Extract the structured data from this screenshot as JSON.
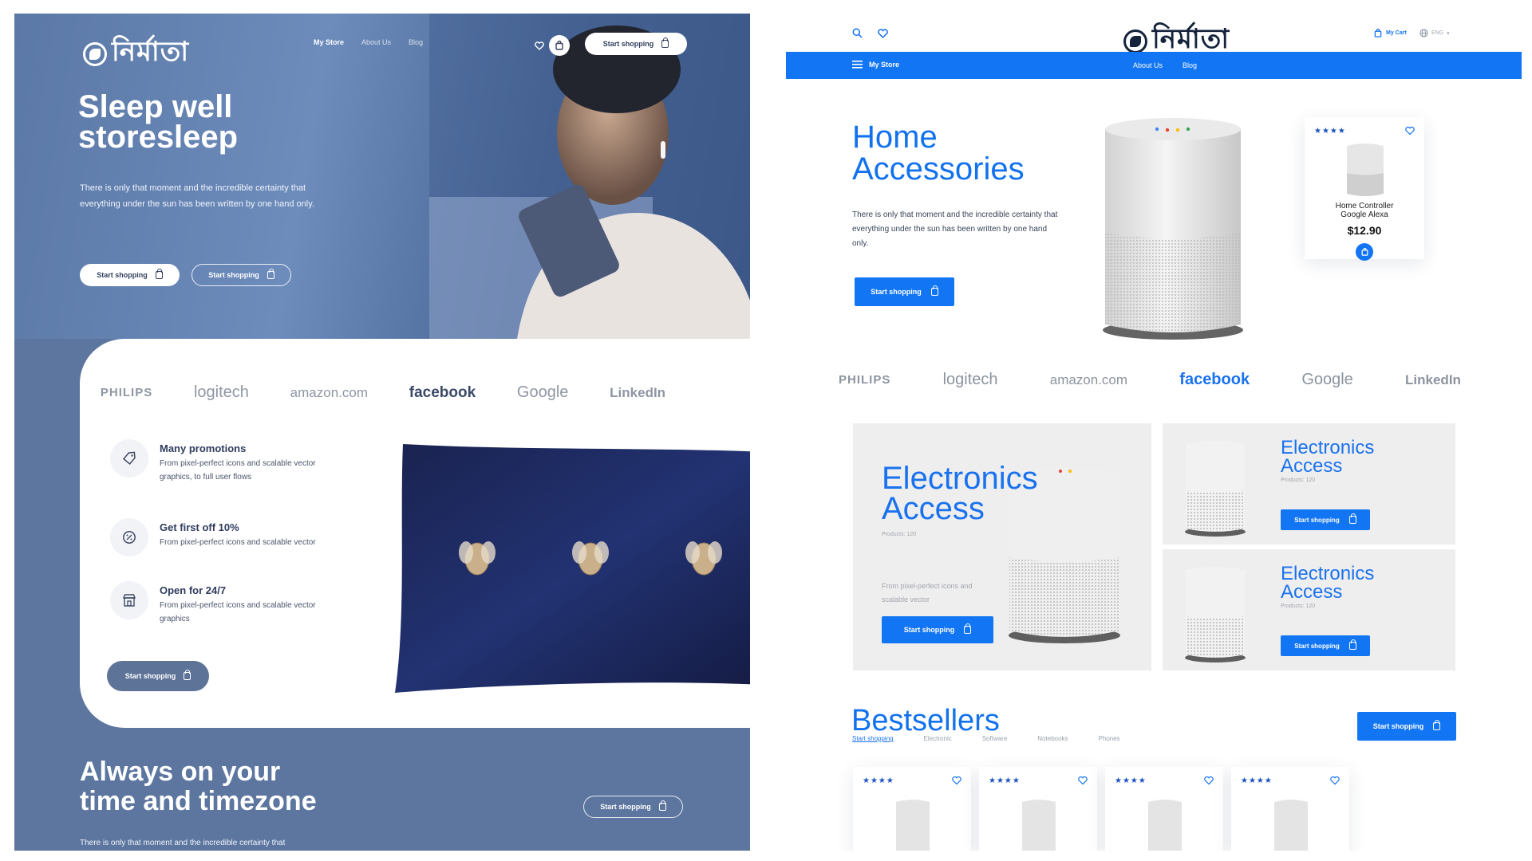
{
  "left": {
    "logo": "নির্মাতা",
    "nav": {
      "store": "My Store",
      "about": "About Us",
      "blog": "Blog"
    },
    "header_button": "Start shopping",
    "hero": {
      "title_line1": "Sleep well",
      "title_line2": "storesleep",
      "text": "There is only that moment and the incredible certainty that everything under the sun has been written by one hand only.",
      "button_primary": "Start shopping",
      "button_secondary": "Start shopping"
    },
    "brands": [
      "PHILIPS",
      "logitech",
      "amazon.com",
      "facebook",
      "Google",
      "LinkedIn"
    ],
    "features": [
      {
        "title": "Many promotions",
        "text": "From pixel-perfect icons and scalable vector graphics, to full user flows",
        "icon": "tag-icon"
      },
      {
        "title": "Get first off 10%",
        "text": "From pixel-perfect icons and scalable vector",
        "icon": "percent-icon"
      },
      {
        "title": "Open for 24/7",
        "text": "From pixel-perfect icons and scalable vector graphics",
        "icon": "store-icon"
      }
    ],
    "features_button": "Start shopping",
    "bottom": {
      "title_line1": "Always on your",
      "title_line2": "time and timezone",
      "text": "There is only that moment and the incredible certainty that",
      "button": "Start shopping"
    }
  },
  "right": {
    "logo": "নির্মাতা",
    "my_cart": "My Cart",
    "lang": "ENG",
    "nav": {
      "store": "My Store",
      "about": "About Us",
      "blog": "Blog"
    },
    "hero": {
      "title_line1": "Home",
      "title_line2": "Accessories",
      "text": "There is only that moment and the incredible certainty that everything under the sun has been written by one hand only.",
      "button": "Start shopping"
    },
    "featured_product": {
      "stars": "★★★★",
      "name_line1": "Home Controller",
      "name_line2": "Google Alexa",
      "price": "$12.90"
    },
    "brands": [
      "PHILIPS",
      "logitech",
      "amazon.com",
      "facebook",
      "Google",
      "LinkedIn"
    ],
    "tiles": {
      "big": {
        "title_line1": "Electronics",
        "title_line2": "Access",
        "sub": "Products: 120",
        "text": "From pixel-perfect icons and scalable vector",
        "button": "Start shopping"
      },
      "top": {
        "title_line1": "Electronics",
        "title_line2": "Access",
        "sub": "Products: 120",
        "button": "Start shopping"
      },
      "bottom": {
        "title_line1": "Electronics",
        "title_line2": "Access",
        "sub": "Products: 120",
        "button": "Start shopping"
      }
    },
    "bestsellers": {
      "title": "Bestsellers",
      "tabs": [
        "Start shopping",
        "Electronic",
        "Software",
        "Notebooks",
        "Phones"
      ],
      "button": "Start shopping",
      "card_stars": "★★★★"
    }
  },
  "colors": {
    "slate": "#5d769f",
    "blue": "#1275f3",
    "blue_text": "#1272ee",
    "navy_pillow": "#1c2860"
  }
}
